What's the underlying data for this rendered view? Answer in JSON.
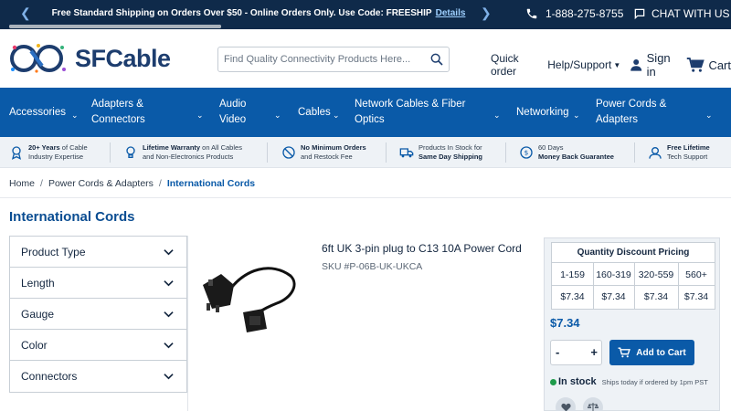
{
  "topbar": {
    "promo_text": "Free Standard Shipping on Orders Over $50 - Online Orders Only. Use Code: FREESHIP",
    "details_link": "Details",
    "phone": "1-888-275-8755",
    "chat": "CHAT WITH US"
  },
  "header": {
    "logo_text": "SFCable",
    "search_placeholder": "Find Quality Connectivity Products Here...",
    "quick_order": "Quick order",
    "help_support": "Help/Support",
    "sign_in": "Sign in",
    "cart": "Cart"
  },
  "nav": {
    "items": [
      {
        "label": "Accessories"
      },
      {
        "label": "Adapters & Connectors"
      },
      {
        "label": "Audio Video"
      },
      {
        "label": "Cables"
      },
      {
        "label": "Network Cables & Fiber Optics"
      },
      {
        "label": "Networking"
      },
      {
        "label": "Power Cords & Adapters"
      }
    ]
  },
  "benefits": [
    {
      "bold": "20+ Years",
      "text1": " of Cable",
      "line2": "Industry Expertise"
    },
    {
      "bold": "Lifetime Warranty",
      "text1": " on All Cables",
      "line2": "and Non-Electronics Products"
    },
    {
      "bold": "No Minimum Orders",
      "text1": "",
      "line2": "and Restock Fee"
    },
    {
      "bold": "",
      "text1": "Products In Stock for",
      "line2": "Same Day Shipping"
    },
    {
      "bold": "",
      "text1": "60 Days",
      "line2": "Money Back Guarantee"
    },
    {
      "bold": "Free Lifetime",
      "text1": "",
      "line2": "Tech Support"
    }
  ],
  "breadcrumb": {
    "home": "Home",
    "parent": "Power Cords & Adapters",
    "current": "International Cords"
  },
  "page_title": "International Cords",
  "filters": [
    {
      "label": "Product Type"
    },
    {
      "label": "Length"
    },
    {
      "label": "Gauge"
    },
    {
      "label": "Color"
    },
    {
      "label": "Connectors"
    }
  ],
  "product": {
    "title": "6ft UK 3-pin plug to C13 10A Power Cord",
    "sku": "SKU #P-06B-UK-UKCA"
  },
  "pricing": {
    "table_title": "Quantity Discount Pricing",
    "tiers": [
      "1-159",
      "160-319",
      "320-559",
      "560+"
    ],
    "prices": [
      "$7.34",
      "$7.34",
      "$7.34",
      "$7.34"
    ],
    "price": "$7.34",
    "quantity": "",
    "add_to_cart": "Add to Cart",
    "stock_status": "In stock",
    "ships_text": "Ships today if ordered by 1pm PST"
  },
  "colors": {
    "navy": "#0f2a4a",
    "brand_blue": "#0a5aa8",
    "in_stock_green": "#1e9b4b"
  },
  "icons": [
    "phone-icon",
    "chat-icon",
    "search-icon",
    "user-icon",
    "cart-icon",
    "chevron-down-icon",
    "heart-icon",
    "compare-icon"
  ]
}
